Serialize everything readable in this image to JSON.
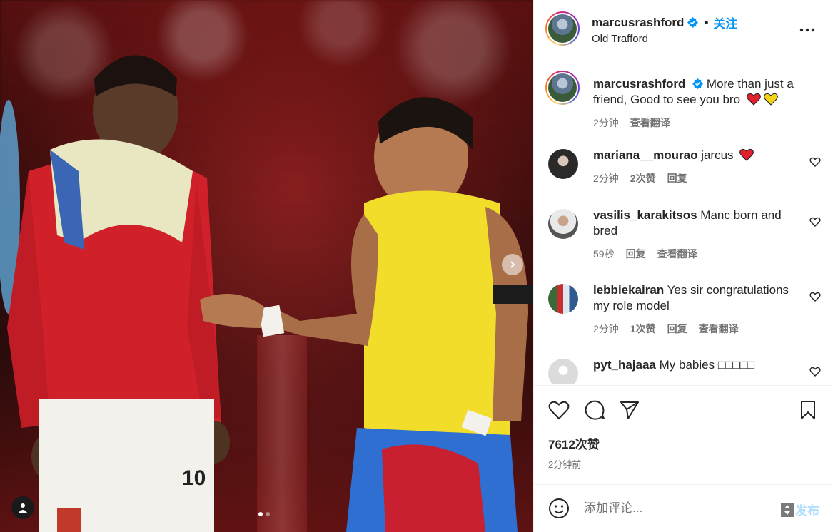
{
  "post": {
    "username": "marcusrashford",
    "follow_label": "关注",
    "location": "Old Trafford",
    "more_icon": "more-horizontal-icon",
    "media_dots": 2,
    "active_dot": 0
  },
  "caption": {
    "username": "marcusrashford",
    "text": "More than just a friend, Good to see you bro",
    "emojis": [
      "red-heart",
      "yellow-heart"
    ],
    "time": "2分钟",
    "translate": "查看翻译"
  },
  "comments": [
    {
      "username": "mariana__mourao",
      "text": "jarcus",
      "emoji": "red-heart",
      "time": "2分钟",
      "likes": "2次赞",
      "reply": "回复",
      "translate": ""
    },
    {
      "username": "vasilis_karakitsos",
      "text": "Manc born and bred",
      "emoji": "",
      "time": "59秒",
      "likes": "",
      "reply": "回复",
      "translate": "查看翻译"
    },
    {
      "username": "lebbiekairan",
      "text": "Yes sir congratulations my role model",
      "emoji": "",
      "time": "2分钟",
      "likes": "1次赞",
      "reply": "回复",
      "translate": "查看翻译"
    },
    {
      "username": "pyt_hajaaa",
      "text": "My babies □□□□□",
      "emoji": "",
      "time": "",
      "likes": "",
      "reply": "",
      "translate": ""
    }
  ],
  "actions": {
    "likes": "7612次赞",
    "time_ago": "2分钟前"
  },
  "composer": {
    "placeholder": "添加评论...",
    "post_label": "发布"
  },
  "colors": {
    "accent": "#0095f6",
    "post_disabled": "#b2dffc",
    "secondary_text": "#737373",
    "like_red": "#ed4956"
  }
}
